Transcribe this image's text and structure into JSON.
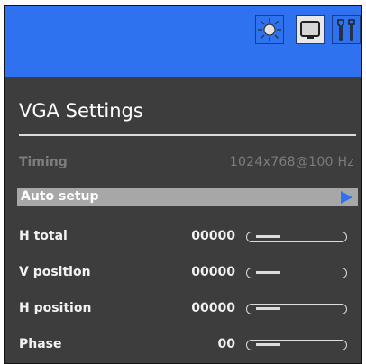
{
  "toolbar": {
    "icons": [
      "brightness-icon",
      "monitor-icon",
      "tools-icon"
    ],
    "active_icon": "monitor-icon",
    "colors": {
      "bar": "#2e72f0",
      "panel": "#3d3d3d",
      "accent": "#2e72f0"
    }
  },
  "page": {
    "title": "VGA Settings"
  },
  "timing": {
    "label": "Timing",
    "value": "1024x768@100 Hz"
  },
  "auto_setup": {
    "label": "Auto setup"
  },
  "settings": [
    {
      "label": "H total",
      "value": "00000",
      "level": 0.3
    },
    {
      "label": "V position",
      "value": "00000",
      "level": 0.3
    },
    {
      "label": "H position",
      "value": "00000",
      "level": 0.3
    },
    {
      "label": "Phase",
      "value": "00",
      "level": 0.3
    }
  ]
}
